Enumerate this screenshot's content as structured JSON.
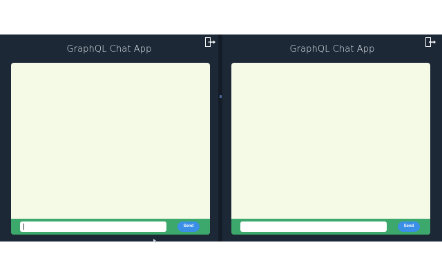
{
  "panes": [
    {
      "title": "GraphQL Chat App",
      "logout_icon": "door-exit-icon",
      "input": {
        "value": "",
        "placeholder": ""
      },
      "send_label": "Send"
    },
    {
      "title": "GraphQL Chat App",
      "logout_icon": "door-exit-icon",
      "input": {
        "value": "",
        "placeholder": ""
      },
      "send_label": "Send"
    }
  ],
  "colors": {
    "app_background": "#1c2836",
    "chat_background": "#f5fae7",
    "input_bar": "#3da86b",
    "send_button": "#3b8fe6"
  }
}
